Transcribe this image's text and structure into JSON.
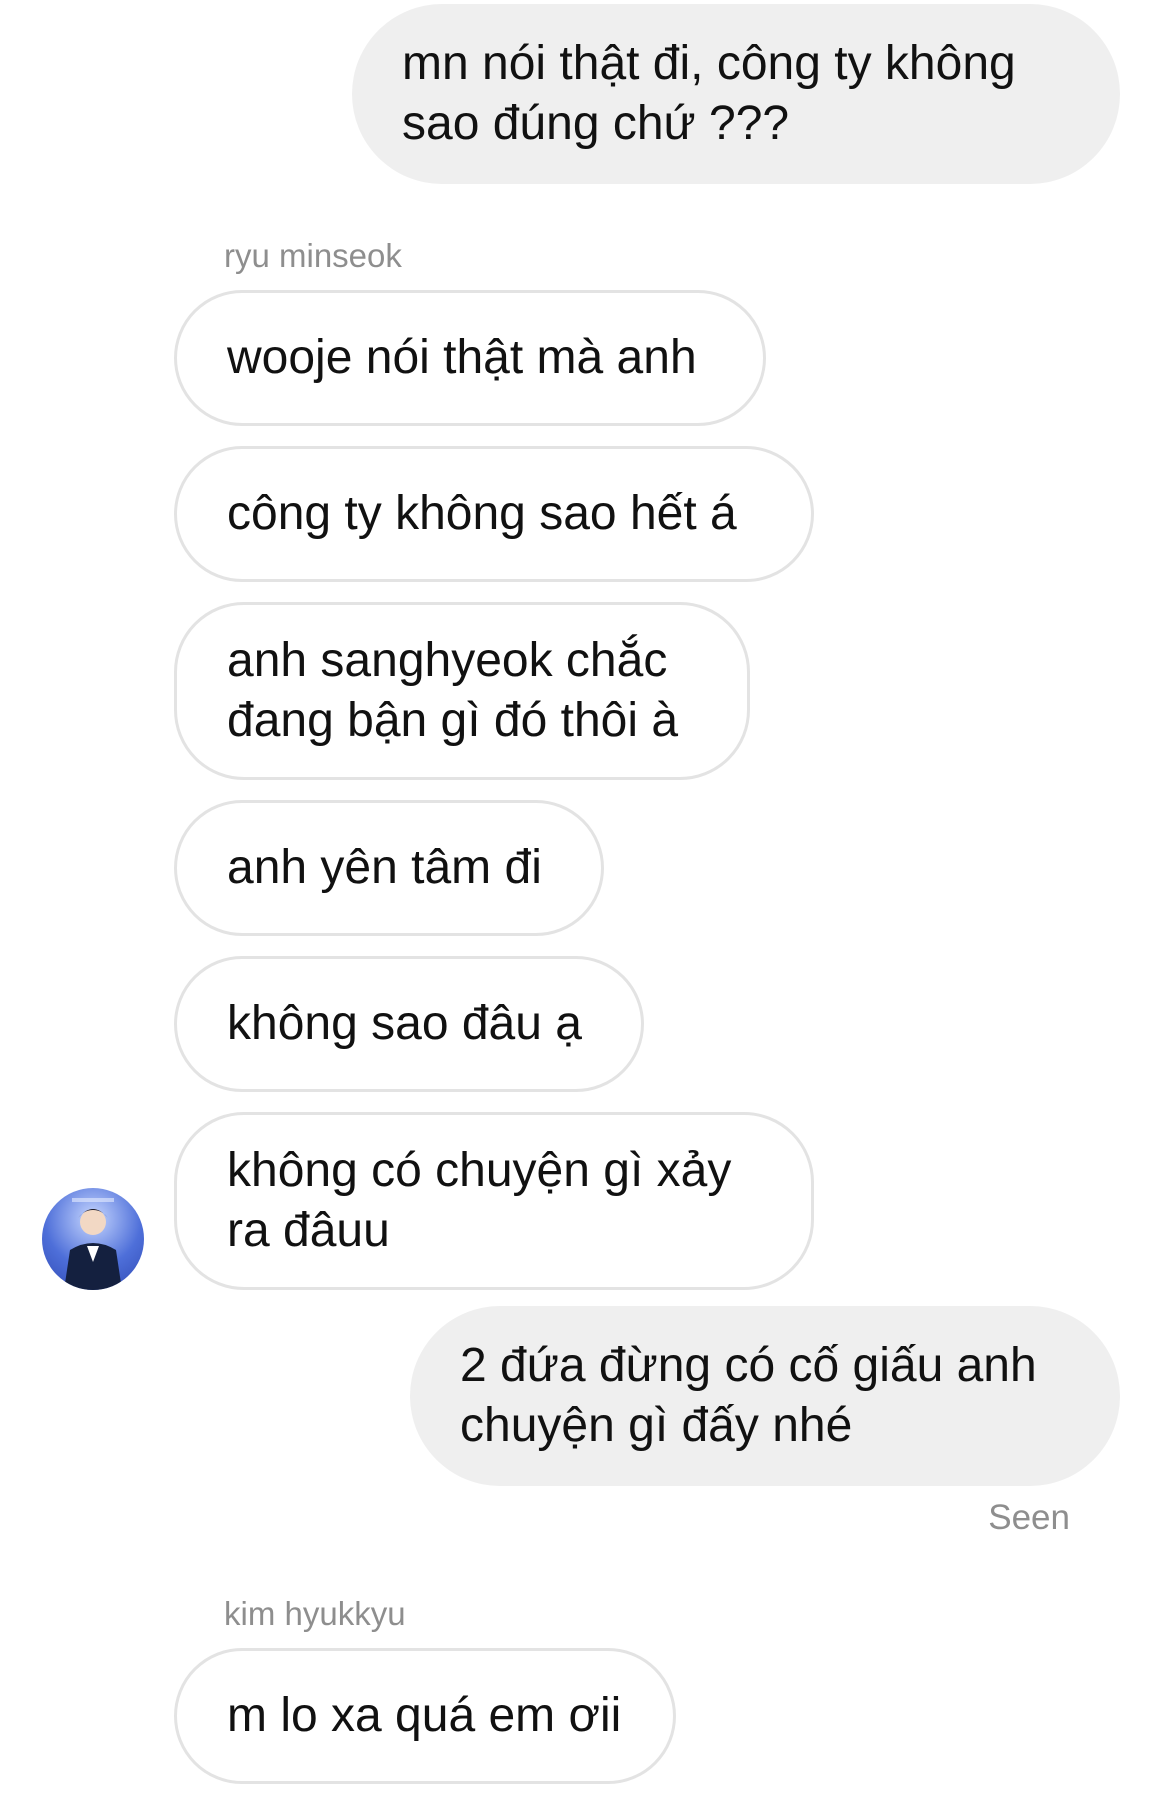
{
  "messages": [
    {
      "id": "m1",
      "direction": "outgoing",
      "text": "mn nói thật đi, công ty không\nsao đúng chứ ???"
    },
    {
      "id": "m2",
      "direction": "incoming",
      "sender": "ryu minseok",
      "text": "wooje nói thật mà anh"
    },
    {
      "id": "m3",
      "direction": "incoming",
      "text": "công ty không sao hết á"
    },
    {
      "id": "m4",
      "direction": "incoming",
      "text": "anh sanghyeok chắc\nđang bận gì đó thôi à"
    },
    {
      "id": "m5",
      "direction": "incoming",
      "text": "anh yên tâm đi"
    },
    {
      "id": "m6",
      "direction": "incoming",
      "text": "không sao đâu ạ"
    },
    {
      "id": "m7",
      "direction": "incoming",
      "text": "không có chuyện gì xảy\nra đâuu"
    },
    {
      "id": "m8",
      "direction": "outgoing",
      "text": "2 đứa đừng có cố giấu anh\nchuyện gì đấy nhé"
    },
    {
      "id": "m9",
      "direction": "incoming",
      "sender": "kim hyukkyu",
      "text": "m lo xa quá em ơii"
    }
  ],
  "senders": {
    "first": "ryu minseok",
    "second": "kim hyukkyu"
  },
  "status": {
    "seen_label": "Seen"
  },
  "avatar": {
    "icon": "user-avatar-icon",
    "background": "#4e6fd9"
  },
  "colors": {
    "outgoing_bubble": "#efefef",
    "incoming_border": "#e3e3e3",
    "meta_text": "#8e8e8e"
  }
}
